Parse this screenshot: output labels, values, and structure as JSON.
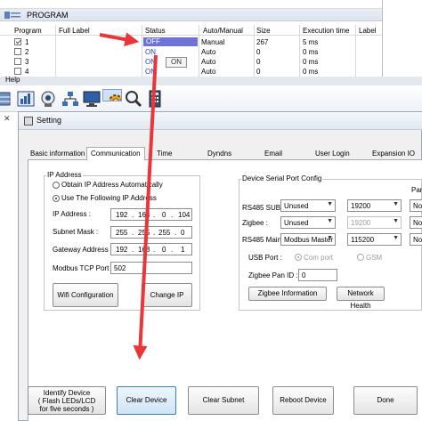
{
  "program_window": {
    "title": "PROGRAM",
    "columns": [
      "Program",
      "Full Label",
      "Status",
      "Auto/Manual",
      "Size",
      "Execution time",
      "Label"
    ],
    "rows": [
      {
        "num": "1",
        "checked": true,
        "status": "OFF",
        "mode": "Manual",
        "size": "267",
        "exec": "5 ms"
      },
      {
        "num": "2",
        "checked": false,
        "status": "ON",
        "mode": "Auto",
        "size": "0",
        "exec": "0 ms"
      },
      {
        "num": "3",
        "checked": false,
        "status": "ON",
        "mode": "Auto",
        "size": "0",
        "exec": "0 ms"
      },
      {
        "num": "4",
        "checked": false,
        "status": "ON",
        "mode": "Auto",
        "size": "0",
        "exec": "0 ms"
      }
    ],
    "tooltip": "ON"
  },
  "menu": {
    "help": "Help"
  },
  "toolbar": {
    "icons": [
      "grid-icon",
      "chart-icon",
      "webcam-icon",
      "network-icon",
      "monitor-icon",
      "gear-icon",
      "search-icon",
      "calculator-icon"
    ]
  },
  "setting": {
    "title": "Setting",
    "tabs": [
      "Basic information",
      "Communication",
      "Time",
      "Dyndns",
      "Email",
      "User Login",
      "Expansion IO"
    ],
    "ip": {
      "group_label": "IP Address",
      "obtain_auto": "Obtain IP Address Automatically",
      "use_following": "Use The Following IP Address",
      "ip_label": "IP Address :",
      "ip": [
        "192",
        "168",
        "0",
        "104"
      ],
      "mask_label": "Subnet Mask :",
      "mask": [
        "255",
        "255",
        "255",
        "0"
      ],
      "gw_label": "Gateway Address :",
      "gw": [
        "192",
        "168",
        "0",
        "1"
      ],
      "tcp_label": "Modbus TCP Port :",
      "tcp_port": "502",
      "wifi_btn": "Wifi Configuration",
      "change_ip_btn": "Change IP"
    },
    "serial": {
      "group_label": "Device Serial Port Config",
      "rs485sub_label": "RS485 SUB :",
      "rs485sub_mode": "Unused",
      "rs485sub_baud": "19200",
      "rs485sub_extra": "No",
      "zigbee_label": "Zigbee :",
      "zigbee_mode": "Unused",
      "zigbee_baud": "19200",
      "zigbee_extra": "No",
      "rs485main_label": "RS485 Main :",
      "rs485main_mode": "Modbus Master",
      "rs485main_baud": "115200",
      "rs485main_extra": "No",
      "extra_header": "Par",
      "usb_label": "USB Port :",
      "usb_opt1": "Com port",
      "usb_opt2": "GSM",
      "pan_label": "Zigbee Pan ID :",
      "pan_id": "0",
      "zigbee_info_btn": "Zigbee Information",
      "network_health_btn": "Network Health"
    },
    "bottom": {
      "identify_line1": "Identify Device",
      "identify_line2": "( Flash LEDs/LCD",
      "identify_line3": "for five seconds )",
      "clear_device": "Clear Device",
      "clear_subnet": "Clear Subnet Database",
      "reboot": "Reboot Device",
      "done": "Done"
    }
  },
  "colors": {
    "arrow": "#e8363a",
    "off_highlight": "#6f73d6",
    "status_blue": "#1f3fd6"
  }
}
